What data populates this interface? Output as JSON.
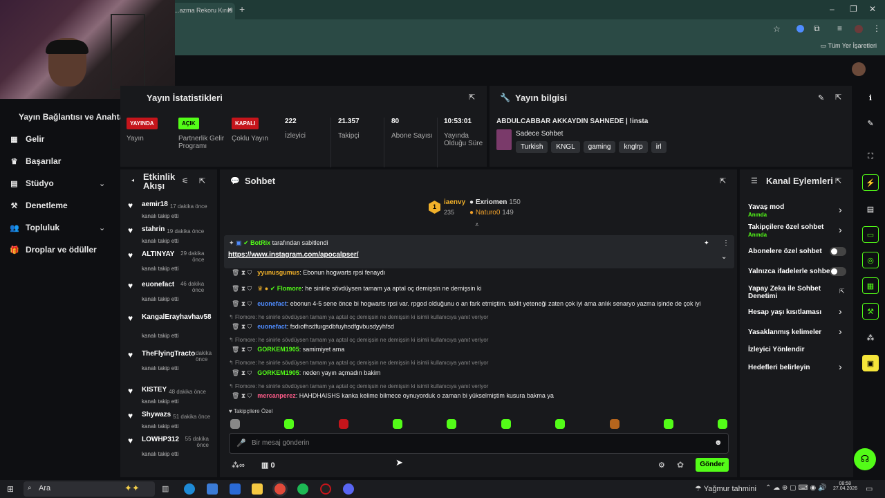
{
  "browser": {
    "tab_title": "...azma Rekoru Kırıld",
    "bookmarks_label": "Tüm Yer İşaretleri"
  },
  "sidebar": {
    "title": "Yayın Bağlantısı ve Anahtarı",
    "items": [
      {
        "label": "Gelir",
        "icon": "dollar-icon"
      },
      {
        "label": "Başarılar",
        "icon": "trophy-icon"
      },
      {
        "label": "Stüdyo",
        "icon": "studio-icon"
      },
      {
        "label": "Denetleme",
        "icon": "moderation-icon"
      },
      {
        "label": "Topluluk",
        "icon": "community-icon"
      },
      {
        "label": "Droplar ve ödüller",
        "icon": "gift-icon"
      }
    ]
  },
  "stats_panel": {
    "title": "Yayın İstatistikleri",
    "stats": [
      {
        "badge": "YAYINDA",
        "label": "Yayın"
      },
      {
        "badge": "AÇIK",
        "label": "Partnerlik Gelir Programı"
      },
      {
        "badge": "KAPALI",
        "label": "Çoklu Yayın"
      },
      {
        "value": "222",
        "label": "İzleyici"
      },
      {
        "value": "21.357",
        "label": "Takipçi"
      },
      {
        "value": "80",
        "label": "Abone Sayısı"
      },
      {
        "value": "10:53:01",
        "label": "Yayında Olduğu Süre"
      }
    ]
  },
  "info_panel": {
    "title": "Yayın bilgisi",
    "stream_title": "ABDULCABBAR AKKAYDIN SAHNEDE | !insta",
    "category": "Sadece Sohbet",
    "tags": [
      "Turkish",
      "KNGL",
      "gaming",
      "knglrp",
      "irl"
    ]
  },
  "activity": {
    "title": "Etkinlik Akışı",
    "items": [
      {
        "name": "aemir18",
        "time": "17 dakika önce",
        "sub": "kanalı takip etti"
      },
      {
        "name": "stahrin",
        "time": "19 dakika önce",
        "sub": "kanalı takip etti"
      },
      {
        "name": "ALTINYAY",
        "time": "29 dakika önce",
        "sub": "kanalı takip etti"
      },
      {
        "name": "euonefact",
        "time": "46 dakika önce",
        "sub": "kanalı takip etti"
      },
      {
        "name": "KangalErayhavhav58",
        "time": "",
        "sub": "kanalı takip etti"
      },
      {
        "name": "TheFlyingTractor",
        "time": "dakika önce",
        "sub": "kanalı takip etti"
      },
      {
        "name": "KISTEY",
        "time": "48 dakika önce",
        "sub": "kanalı takip etti"
      },
      {
        "name": "Shywazs",
        "time": "51 dakika önce",
        "sub": "kanalı takip etti"
      },
      {
        "name": "LOWHP312",
        "time": "55 dakika önce",
        "sub": "kanalı takip etti"
      }
    ]
  },
  "chat": {
    "title": "Sohbet",
    "leaders": [
      {
        "rank": "1",
        "name": "iaenvy",
        "value": "235"
      },
      {
        "name": "Exriomen",
        "value": "150"
      },
      {
        "name": "Naturo0",
        "value": "149"
      }
    ],
    "pinned_by": "BotRix",
    "pinned_suffix": "tarafından sabitlendi",
    "pinned_link": "https://www.instagram.com/apocalpser/",
    "reply_text": "Flomore: he sinirle sövdüysen tamam ya aptal oç demişsin ne demişsin ki isimli kullanıcıya yanıt veriyor",
    "messages": [
      {
        "user": "yyunusgumus",
        "text": ": Ebonun hogwarts rpsi fenaydı"
      },
      {
        "user": "Flomore",
        "text": ": he sinirle sövdüysen tamam ya aptal oç demişsin ne demişsin ki"
      },
      {
        "user": "euonefact",
        "text": ": ebonun 4-5 sene önce bi hogwarts rpsi var. rpgod olduğunu o an fark etmiştim. taklit yeteneği zaten çok iyi ama anlık senaryo yazma işinde de çok iyi"
      },
      {
        "user": "euonefact",
        "text": ": fsdıofhsdfuıgsdbfuyhsdfgvbusdyyhfsd"
      },
      {
        "user": "GORKEM1905",
        "text": ": samimiyet ama"
      },
      {
        "user": "GORKEM1905",
        "text": ": neden yayın açmadın bakim"
      },
      {
        "user": "mercanperez",
        "text": ": HAHDHAISHS kanka kelime bilmece oynuyorduk o zaman bi yükselmiştim kusura bakma ya"
      }
    ],
    "emote_label": "Takipçilere Özel",
    "input_placeholder": "Bir mesaj gönderin",
    "count": "0",
    "send_label": "Gönder"
  },
  "channel_actions": {
    "title": "Kanal Eylemleri",
    "items": [
      {
        "label": "Yavaş mod",
        "sub": "Anında"
      },
      {
        "label": "Takipçilere özel sohbet",
        "sub": "Anında"
      },
      {
        "label": "Abonelere özel sohbet"
      },
      {
        "label": "Yalnızca ifadelerle sohbet"
      },
      {
        "label": "Yapay Zeka ile Sohbet Denetimi"
      },
      {
        "label": "Hesap yaşı kısıtlaması"
      },
      {
        "label": "Yasaklanmış kelimeler"
      },
      {
        "label": "İzleyici Yönlendir"
      },
      {
        "label": "Hedefleri belirleyin"
      }
    ]
  },
  "taskbar": {
    "search": "Ara",
    "weather": "Yağmur tahmini",
    "time": "08:58",
    "date": "27.04.2026"
  },
  "colors": {
    "accent": "#53fc18",
    "live": "#c5151b",
    "panel": "#18191c",
    "background": "#0e0f12"
  }
}
